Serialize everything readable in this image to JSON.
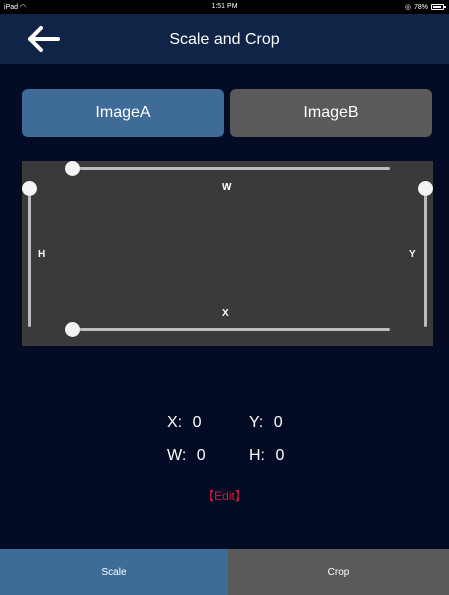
{
  "status_bar": {
    "device": "iPad",
    "time": "1:51 PM",
    "battery": "78%"
  },
  "nav": {
    "title": "Scale and Crop",
    "back_icon": "arrow-left-icon"
  },
  "tabs": [
    {
      "label": "ImageA",
      "active": true
    },
    {
      "label": "ImageB",
      "active": false
    }
  ],
  "crop_area": {
    "labels": {
      "w": "W",
      "h": "H",
      "x": "X",
      "y": "Y"
    }
  },
  "values": {
    "x_label": "X:",
    "x_value": "0",
    "y_label": "Y:",
    "y_value": "0",
    "w_label": "W:",
    "w_value": "0",
    "h_label": "H:",
    "h_value": "0"
  },
  "edit_label": "【Edit】",
  "bottom_tabs": [
    {
      "label": "Scale",
      "active": true
    },
    {
      "label": "Crop",
      "active": false
    }
  ],
  "colors": {
    "background": "#030c24",
    "nav": "#102447",
    "active_tab": "#3f6b98",
    "inactive_tab": "#5a5a5a",
    "edit": "#cc1b3a"
  }
}
